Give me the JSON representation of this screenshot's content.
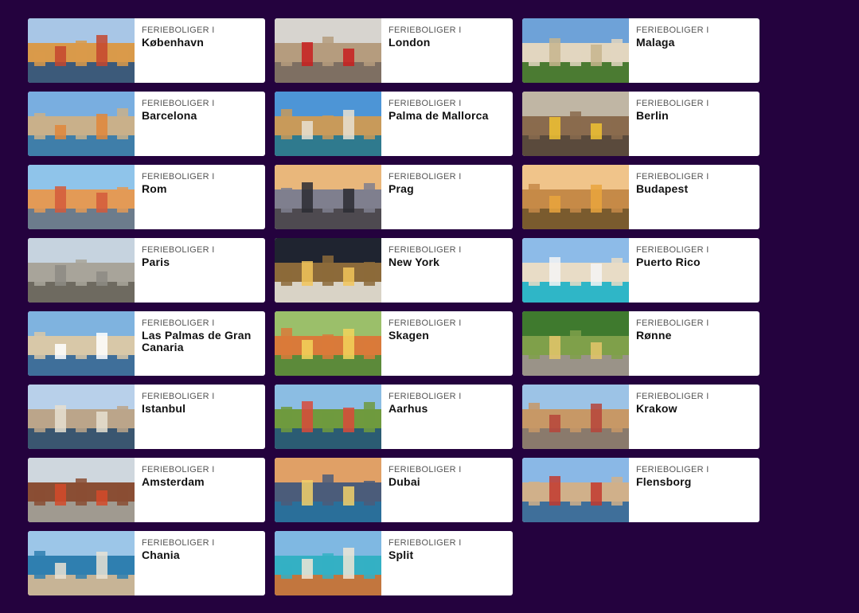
{
  "kicker_label": "FERIEBOLIGER I",
  "destinations": [
    {
      "city": "København",
      "sky": "#a8c6e6",
      "mid": "#d99a4a",
      "low": "#3c5a7a",
      "accent": "#c4472e"
    },
    {
      "city": "London",
      "sky": "#d7d4cf",
      "mid": "#b59c7e",
      "low": "#7e6f62",
      "accent": "#c81e1e"
    },
    {
      "city": "Malaga",
      "sky": "#6ea2d8",
      "mid": "#e2d6bf",
      "low": "#4b7b32",
      "accent": "#c7b58d"
    },
    {
      "city": "Barcelona",
      "sky": "#79aee0",
      "mid": "#c9b08a",
      "low": "#3f7ea9",
      "accent": "#e0873a"
    },
    {
      "city": "Palma de Mallorca",
      "sky": "#4d95d6",
      "mid": "#c89a5a",
      "low": "#2f7a8e",
      "accent": "#e8e1d2"
    },
    {
      "city": "Berlin",
      "sky": "#c0b6a4",
      "mid": "#8a6b4e",
      "low": "#5a4a3c",
      "accent": "#f0c232"
    },
    {
      "city": "Rom",
      "sky": "#8fc4ea",
      "mid": "#e39a56",
      "low": "#6c7c8c",
      "accent": "#d45b3b"
    },
    {
      "city": "Prag",
      "sky": "#e9b77b",
      "mid": "#7f7f8e",
      "low": "#4e4a50",
      "accent": "#2b2b33"
    },
    {
      "city": "Budapest",
      "sky": "#f0c48a",
      "mid": "#c58a48",
      "low": "#7a5b2e",
      "accent": "#e9a43d"
    },
    {
      "city": "Paris",
      "sky": "#c6d3df",
      "mid": "#a8a49a",
      "low": "#6e6a60",
      "accent": "#8d8b84"
    },
    {
      "city": "New York",
      "sky": "#1f2430",
      "mid": "#8c6a3a",
      "low": "#d9d3c6",
      "accent": "#f1c45a"
    },
    {
      "city": "Puerto Rico",
      "sky": "#8dbbe8",
      "mid": "#e8dcc6",
      "low": "#2fb6c7",
      "accent": "#f4f4f4"
    },
    {
      "city": "Las Palmas de Gran Canaria",
      "sky": "#7fb3df",
      "mid": "#d8c8a8",
      "low": "#3f6f9a",
      "accent": "#ffffff"
    },
    {
      "city": "Skagen",
      "sky": "#9bbf6a",
      "mid": "#d97a3a",
      "low": "#5c8a3a",
      "accent": "#f2d35a"
    },
    {
      "city": "Rønne",
      "sky": "#3f7a2e",
      "mid": "#7fa04a",
      "low": "#9a9388",
      "accent": "#e4c56a"
    },
    {
      "city": "Istanbul",
      "sky": "#b8d0ea",
      "mid": "#bba58a",
      "low": "#3a5670",
      "accent": "#e6dfd0"
    },
    {
      "city": "Aarhus",
      "sky": "#8bbde3",
      "mid": "#6f9a3e",
      "low": "#2b5c73",
      "accent": "#d94a3a"
    },
    {
      "city": "Krakow",
      "sky": "#9cc3e6",
      "mid": "#c79866",
      "low": "#8a7a6c",
      "accent": "#b6443a"
    },
    {
      "city": "Amsterdam",
      "sky": "#cfd7de",
      "mid": "#8a4e34",
      "low": "#a09a90",
      "accent": "#d44a2a"
    },
    {
      "city": "Dubai",
      "sky": "#e0a066",
      "mid": "#4b5c7a",
      "low": "#2a6f9a",
      "accent": "#f2d06a"
    },
    {
      "city": "Flensborg",
      "sky": "#8ab8e6",
      "mid": "#d0b08a",
      "low": "#3f6f9a",
      "accent": "#c23a2e"
    },
    {
      "city": "Chania",
      "sky": "#9cc6e8",
      "mid": "#2f7fb0",
      "low": "#c7b496",
      "accent": "#e9e2d4"
    },
    {
      "city": "Split",
      "sky": "#7fb8e2",
      "mid": "#34b0c4",
      "low": "#c2763e",
      "accent": "#efe6d6"
    }
  ]
}
